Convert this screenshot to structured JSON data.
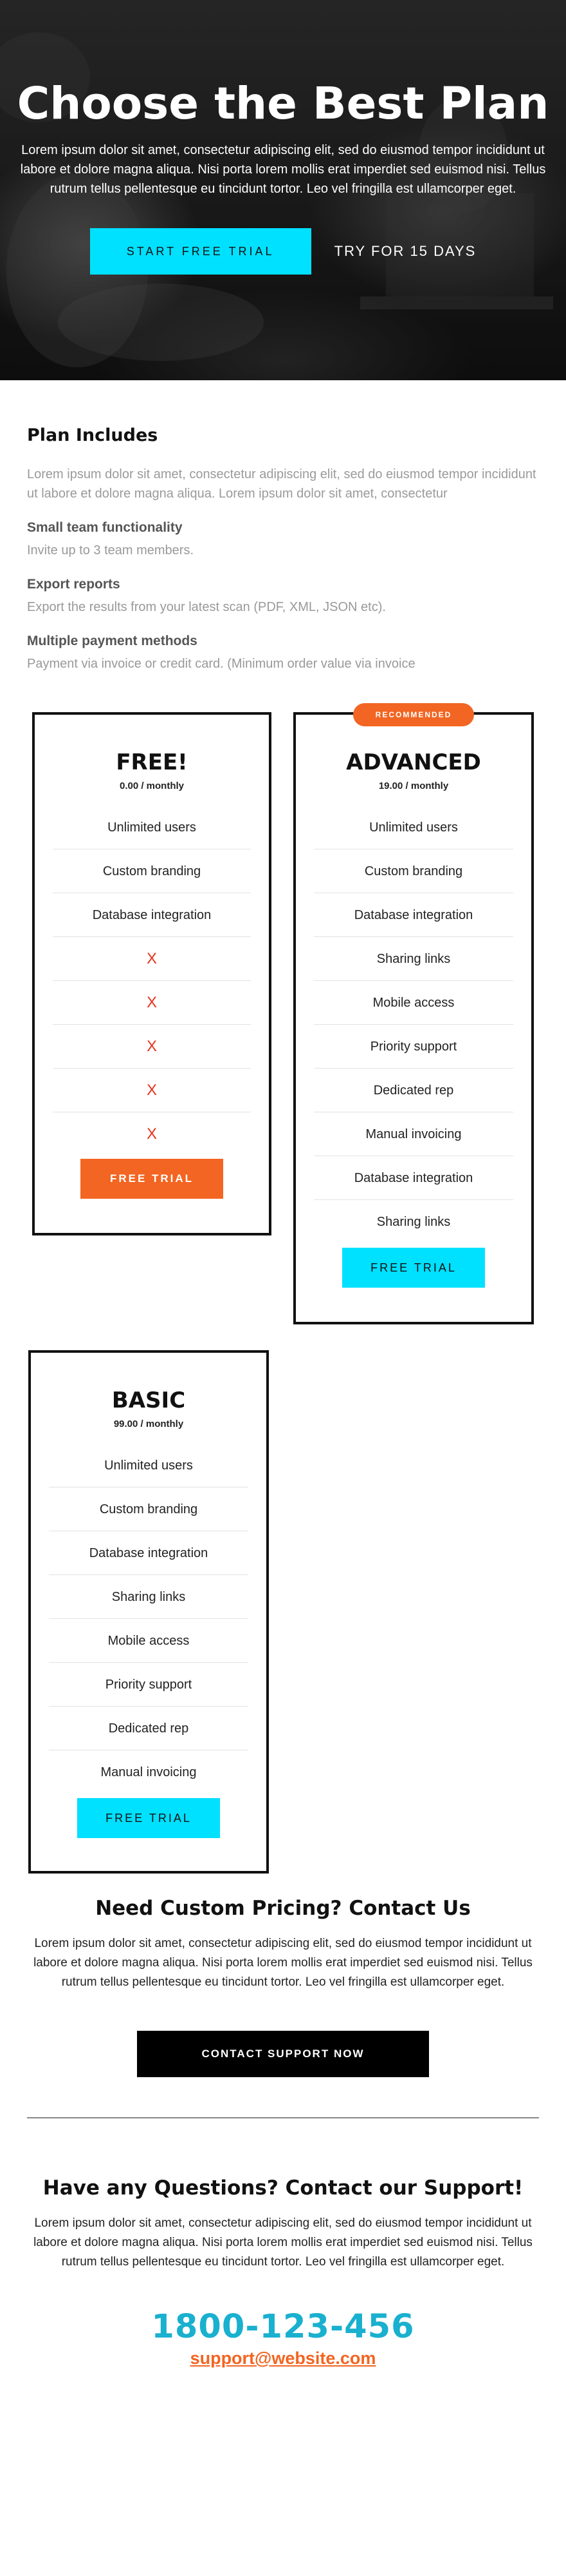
{
  "hero": {
    "title": "Choose the Best Plan",
    "text": "Lorem ipsum dolor sit amet, consectetur adipiscing elit, sed do eiusmod tempor incididunt ut labore et dolore magna aliqua. Nisi porta lorem mollis erat imperdiet sed euismod nisi. Tellus rutrum tellus pellentesque eu tincidunt tortor. Leo vel fringilla est ullamcorper eget.",
    "primary_button": "START FREE TRIAL",
    "secondary_link": "TRY FOR 15 DAYS"
  },
  "includes": {
    "title": "Plan Includes",
    "intro": "Lorem ipsum dolor sit amet, consectetur adipiscing elit, sed do eiusmod tempor incididunt ut labore et dolore magna aliqua. Lorem ipsum dolor sit amet, consectetur",
    "features": [
      {
        "name": "Small team functionality",
        "desc": "Invite up to 3 team members."
      },
      {
        "name": "Export reports",
        "desc": "Export the results from your latest scan (PDF, XML, JSON etc)."
      },
      {
        "name": "Multiple payment methods",
        "desc": "Payment via invoice or credit card. (Minimum order value via invoice"
      }
    ]
  },
  "plans": {
    "free": {
      "name": "FREE!",
      "price": "0.00 / monthly",
      "rows": [
        "Unlimited users",
        "Custom branding",
        "Database integration",
        "X",
        "X",
        "X",
        "X",
        "X"
      ],
      "button": "FREE TRIAL"
    },
    "advanced": {
      "badge": "RECOMMENDED",
      "name": "ADVANCED",
      "price": "19.00 / monthly",
      "rows": [
        "Unlimited users",
        "Custom branding",
        "Database integration",
        "Sharing links",
        "Mobile access",
        "Priority support",
        "Dedicated rep",
        "Manual invoicing",
        "Database integration",
        "Sharing links"
      ],
      "button": "FREE TRIAL"
    },
    "basic": {
      "name": "BASIC",
      "price": "99.00 / monthly",
      "rows": [
        "Unlimited users",
        "Custom branding",
        "Database integration",
        "Sharing links",
        "Mobile access",
        "Priority support",
        "Dedicated rep",
        "Manual invoicing"
      ],
      "button": "FREE TRIAL"
    }
  },
  "custom": {
    "title": "Need Custom Pricing? Contact Us",
    "text": "Lorem ipsum dolor sit amet, consectetur adipiscing elit, sed do eiusmod tempor incididunt ut labore et dolore magna aliqua. Nisi porta lorem mollis erat imperdiet sed euismod nisi. Tellus rutrum tellus pellentesque eu tincidunt tortor. Leo vel fringilla est ullamcorper eget.",
    "button": "CONTACT SUPPORT NOW"
  },
  "support": {
    "title": "Have any Questions? Contact our Support!",
    "text": "Lorem ipsum dolor sit amet, consectetur adipiscing elit, sed do eiusmod tempor incididunt ut labore et dolore magna aliqua. Nisi porta lorem mollis erat imperdiet sed euismod nisi. Tellus rutrum tellus pellentesque eu tincidunt tortor. Leo vel fringilla est ullamcorper eget.",
    "phone": "1800-123-456",
    "email": "support@website.com"
  },
  "colors": {
    "accent_cyan": "#00e0ff",
    "accent_orange": "#f26522",
    "phone_blue": "#1ab0cf",
    "negative_x": "#e8321e"
  }
}
